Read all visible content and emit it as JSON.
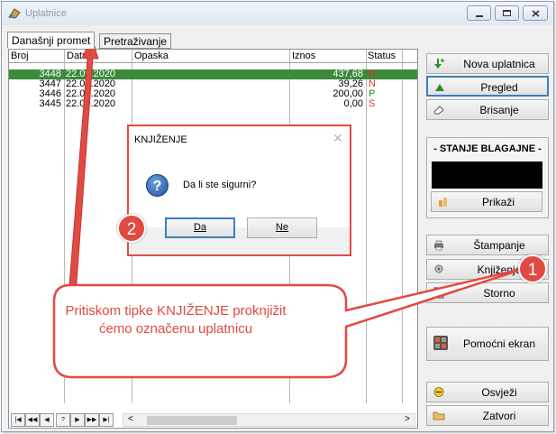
{
  "window": {
    "title": "Uplatnice"
  },
  "tabs": [
    {
      "label": "Današnji promet"
    },
    {
      "label": "Pretraživanje"
    }
  ],
  "grid": {
    "columns": [
      "Broj",
      "Datum",
      "Opaska",
      "Iznos",
      "Status"
    ],
    "rows": [
      {
        "broj": "3448",
        "datum": "22.09.2020",
        "opaska": "",
        "iznos": "437,68",
        "status": "N",
        "status_color": "#e03030"
      },
      {
        "broj": "3447",
        "datum": "22.09.2020",
        "opaska": "",
        "iznos": "39,26",
        "status": "N",
        "status_color": "#e03030"
      },
      {
        "broj": "3446",
        "datum": "22.09.2020",
        "opaska": "",
        "iznos": "200,00",
        "status": "P",
        "status_color": "#1c9a1c"
      },
      {
        "broj": "3445",
        "datum": "22.09.2020",
        "opaska": "",
        "iznos": "0,00",
        "status": "S",
        "status_color": "#e03030"
      }
    ],
    "nav_buttons": [
      "|◀",
      "◀◀",
      "◀",
      "?",
      "▶",
      "▶▶",
      "▶|"
    ],
    "scroll_left": "<",
    "scroll_right": ">"
  },
  "sidebar": {
    "nova_uplatnica": "Nova uplatnica",
    "pregled": "Pregled",
    "brisanje": "Brisanje",
    "stanje_blagajne": "- STANJE BLAGAJNE -",
    "prikazi": "Prikaži",
    "stampanje": "Štampanje",
    "knjizenje": "Knjiženje",
    "storno": "Storno",
    "pomocni_ekran": "Pomoćni ekran",
    "osvjezi": "Osvježi",
    "zatvori": "Zatvori"
  },
  "dialog": {
    "title": "KNJIŽENJE",
    "close": "✕",
    "message": "Da li ste sigurni?",
    "yes": "Da",
    "no": "Ne"
  },
  "annotations": {
    "badge1": "1",
    "badge2": "2",
    "callout": "Pritiskom tipke KNJIŽENJE proknjižit ćemo označenu uplatnicu"
  },
  "colors": {
    "accent_red": "#e14a42",
    "selected_row": "#3c8a3c",
    "focus_blue": "#3d7fbf"
  }
}
